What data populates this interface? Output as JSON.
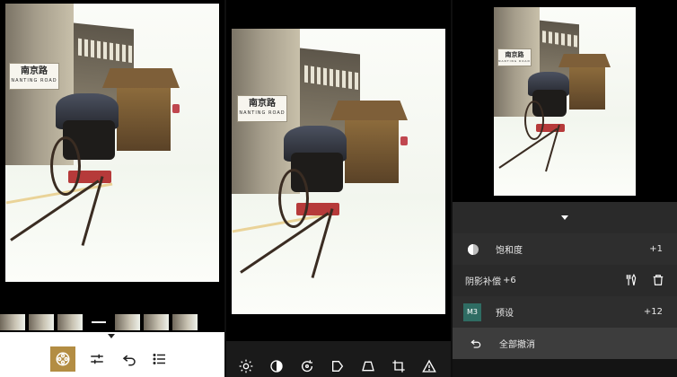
{
  "panel_left": {
    "photo_sign": {
      "cn": "南京路",
      "en": "NANTING ROAD"
    },
    "filmstrip_count": 7,
    "toolbar": [
      {
        "name": "looks-tool",
        "icon": "film-reel-icon",
        "active": true
      },
      {
        "name": "adjust-tool",
        "icon": "sliders-icon",
        "active": false
      },
      {
        "name": "undo-tool",
        "icon": "undo-icon",
        "active": false
      },
      {
        "name": "list-tool",
        "icon": "list-icon",
        "active": false
      }
    ]
  },
  "panel_middle": {
    "photo_sign": {
      "cn": "南京路",
      "en": "NANTING ROAD"
    },
    "bottom_icons": [
      "brightness-icon",
      "contrast-icon",
      "rotate-icon",
      "perspective-icon",
      "trapezoid-icon",
      "crop-icon",
      "warning-icon"
    ]
  },
  "panel_right": {
    "photo_sign": {
      "cn": "南京路",
      "en": "NANTING ROAD"
    },
    "rows": [
      {
        "label": "饱和度",
        "value": "+1",
        "icon": "saturation-icon"
      },
      {
        "label": "阴影补偿",
        "value": "+6",
        "actions": [
          "brush-icon",
          "trash-icon"
        ]
      },
      {
        "label": "预设",
        "value": "+12",
        "badge": "M3"
      },
      {
        "label": "全部撤消",
        "icon": "undo-icon"
      }
    ]
  },
  "colors": {
    "accent": "#b38d43",
    "badge": "#2f6c63",
    "list_bg": "#2e2e2e",
    "highlight_row": "#3d3d3d"
  }
}
